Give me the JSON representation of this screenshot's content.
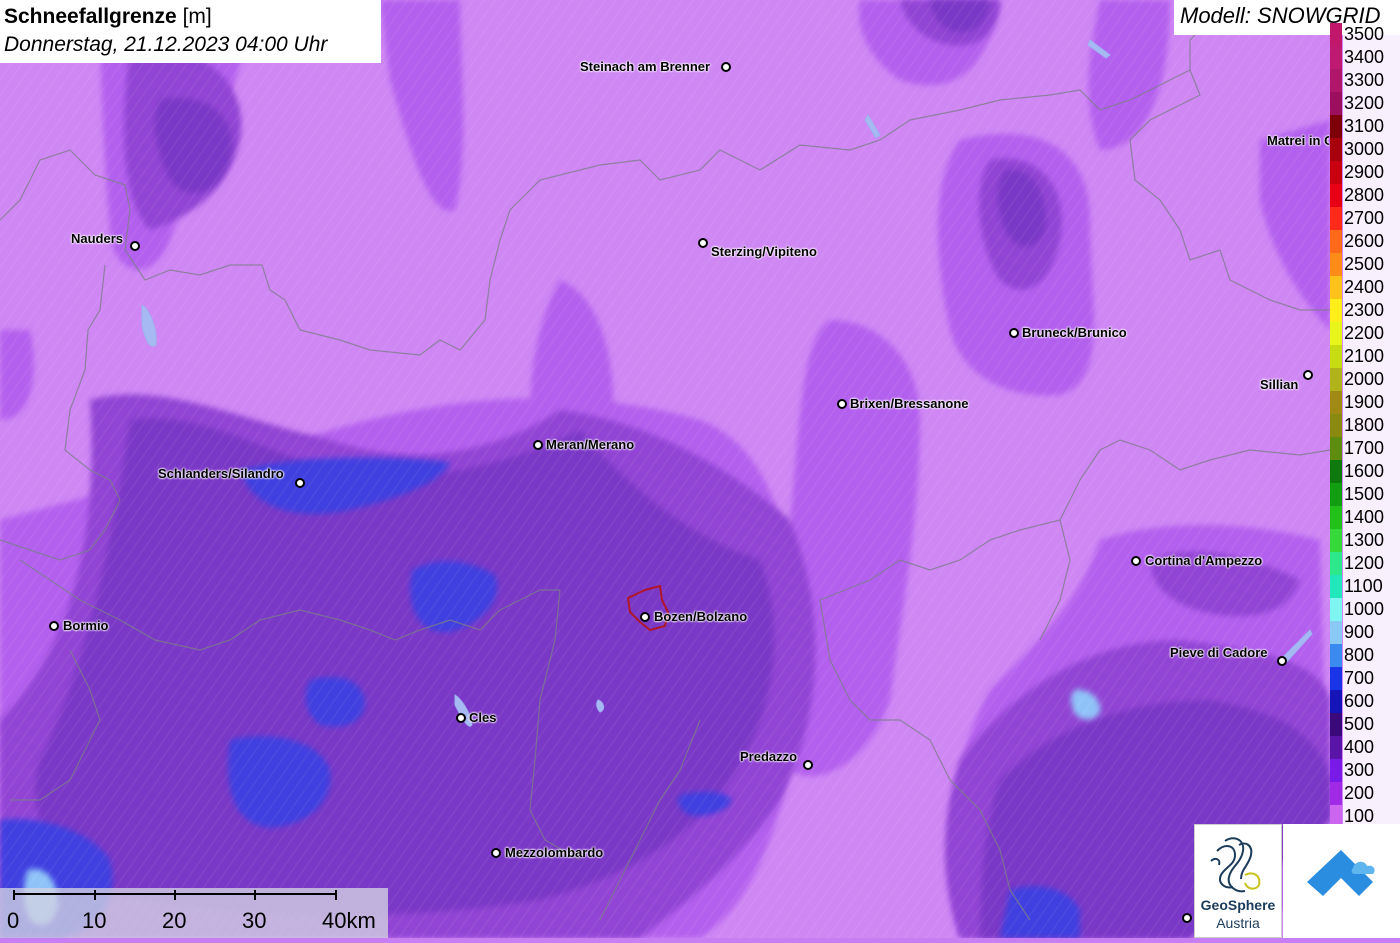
{
  "title": {
    "bold": "Schneefallgrenze",
    "unit": " [m]",
    "datetime": "Donnerstag, 21.12.2023 04:00 Uhr"
  },
  "model": "Modell: SNOWGRID",
  "cities": [
    {
      "name": "Steinach am Brenner",
      "label": "Steinach am Brenner"
    },
    {
      "name": "Nauders",
      "label": "Nauders"
    },
    {
      "name": "Sterzing",
      "label": "Sterzing/Vipiteno"
    },
    {
      "name": "Matrei",
      "label": "Matrei in Osttirol"
    },
    {
      "name": "Bruneck",
      "label": "Bruneck/Brunico"
    },
    {
      "name": "Sillian",
      "label": "Sillian"
    },
    {
      "name": "Brixen",
      "label": "Brixen/Bressanone"
    },
    {
      "name": "Meran",
      "label": "Meran/Merano"
    },
    {
      "name": "Schlanders",
      "label": "Schlanders/Silandro"
    },
    {
      "name": "Cortina",
      "label": "Cortina d'Ampezzo"
    },
    {
      "name": "Bormio",
      "label": "Bormio"
    },
    {
      "name": "Bozen",
      "label": "Bozen/Bolzano"
    },
    {
      "name": "Pieve",
      "label": "Pieve di Cadore"
    },
    {
      "name": "Cles",
      "label": "Cles"
    },
    {
      "name": "Predazzo",
      "label": "Predazzo"
    },
    {
      "name": "Mezzolombardo",
      "label": "Mezzolombardo"
    }
  ],
  "legend": {
    "items": [
      {
        "value": "3500",
        "color": "#c2186b"
      },
      {
        "value": "3400",
        "color": "#be1a72"
      },
      {
        "value": "3300",
        "color": "#b0166a"
      },
      {
        "value": "3200",
        "color": "#9b0f5e"
      },
      {
        "value": "3100",
        "color": "#7d0008"
      },
      {
        "value": "3000",
        "color": "#a8000c"
      },
      {
        "value": "2900",
        "color": "#c90010"
      },
      {
        "value": "2800",
        "color": "#e80014"
      },
      {
        "value": "2700",
        "color": "#ff2a1a"
      },
      {
        "value": "2600",
        "color": "#ff6a1a"
      },
      {
        "value": "2500",
        "color": "#ff8c18"
      },
      {
        "value": "2400",
        "color": "#ffc21a"
      },
      {
        "value": "2300",
        "color": "#ffee1a"
      },
      {
        "value": "2200",
        "color": "#e8f51a"
      },
      {
        "value": "2100",
        "color": "#c8dc14"
      },
      {
        "value": "2000",
        "color": "#b0b41a"
      },
      {
        "value": "1900",
        "color": "#a08a14"
      },
      {
        "value": "1800",
        "color": "#8a8a10"
      },
      {
        "value": "1700",
        "color": "#5e8c0e"
      },
      {
        "value": "1600",
        "color": "#0e7a0e"
      },
      {
        "value": "1500",
        "color": "#119e11"
      },
      {
        "value": "1400",
        "color": "#22c11a"
      },
      {
        "value": "1300",
        "color": "#37d93a"
      },
      {
        "value": "1200",
        "color": "#2ce88a"
      },
      {
        "value": "1100",
        "color": "#22e6bc"
      },
      {
        "value": "1000",
        "color": "#7ef5f0"
      },
      {
        "value": "900",
        "color": "#8ac8f5"
      },
      {
        "value": "800",
        "color": "#3a8af0"
      },
      {
        "value": "700",
        "color": "#1a34e8"
      },
      {
        "value": "600",
        "color": "#1414b8"
      },
      {
        "value": "500",
        "color": "#3a0a7a"
      },
      {
        "value": "400",
        "color": "#5a14a8"
      },
      {
        "value": "300",
        "color": "#7a1ae8"
      },
      {
        "value": "200",
        "color": "#a02ae6"
      },
      {
        "value": "100",
        "color": "#cc66f0"
      }
    ]
  },
  "scale": {
    "labels": [
      "0",
      "10",
      "20",
      "30",
      "40km"
    ]
  },
  "logos": {
    "geosphere_line1": "GeoSphere",
    "geosphere_line2": "Austria"
  }
}
